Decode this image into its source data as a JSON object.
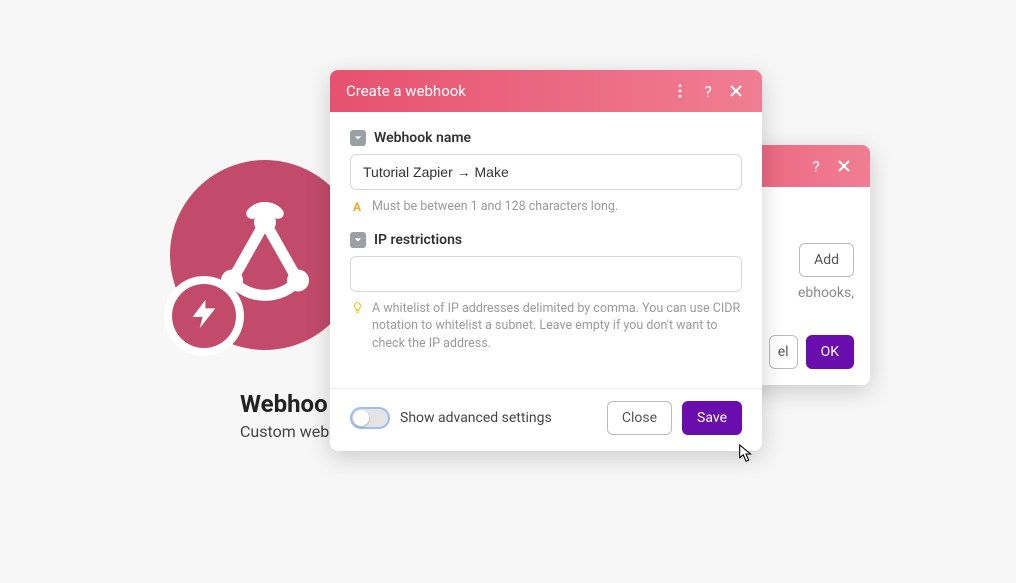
{
  "module": {
    "title": "Webhoo",
    "subtitle": "Custom webh"
  },
  "dialog_back": {
    "add_label": "Add",
    "info_text": "ebhooks,",
    "cancel_label_fragment": "el",
    "ok_label": "OK"
  },
  "dialog_front": {
    "title": "Create a webhook",
    "fields": {
      "name": {
        "label": "Webhook name",
        "value": "Tutorial Zapier → Make",
        "hint": "Must be between 1 and 128 characters long."
      },
      "ip": {
        "label": "IP restrictions",
        "value": "",
        "hint": "A whitelist of IP addresses delimited by comma. You can use CIDR notation to whitelist a subnet. Leave empty if you don't want to check the IP address."
      }
    },
    "footer": {
      "advanced_label": "Show advanced settings",
      "close_label": "Close",
      "save_label": "Save"
    }
  }
}
